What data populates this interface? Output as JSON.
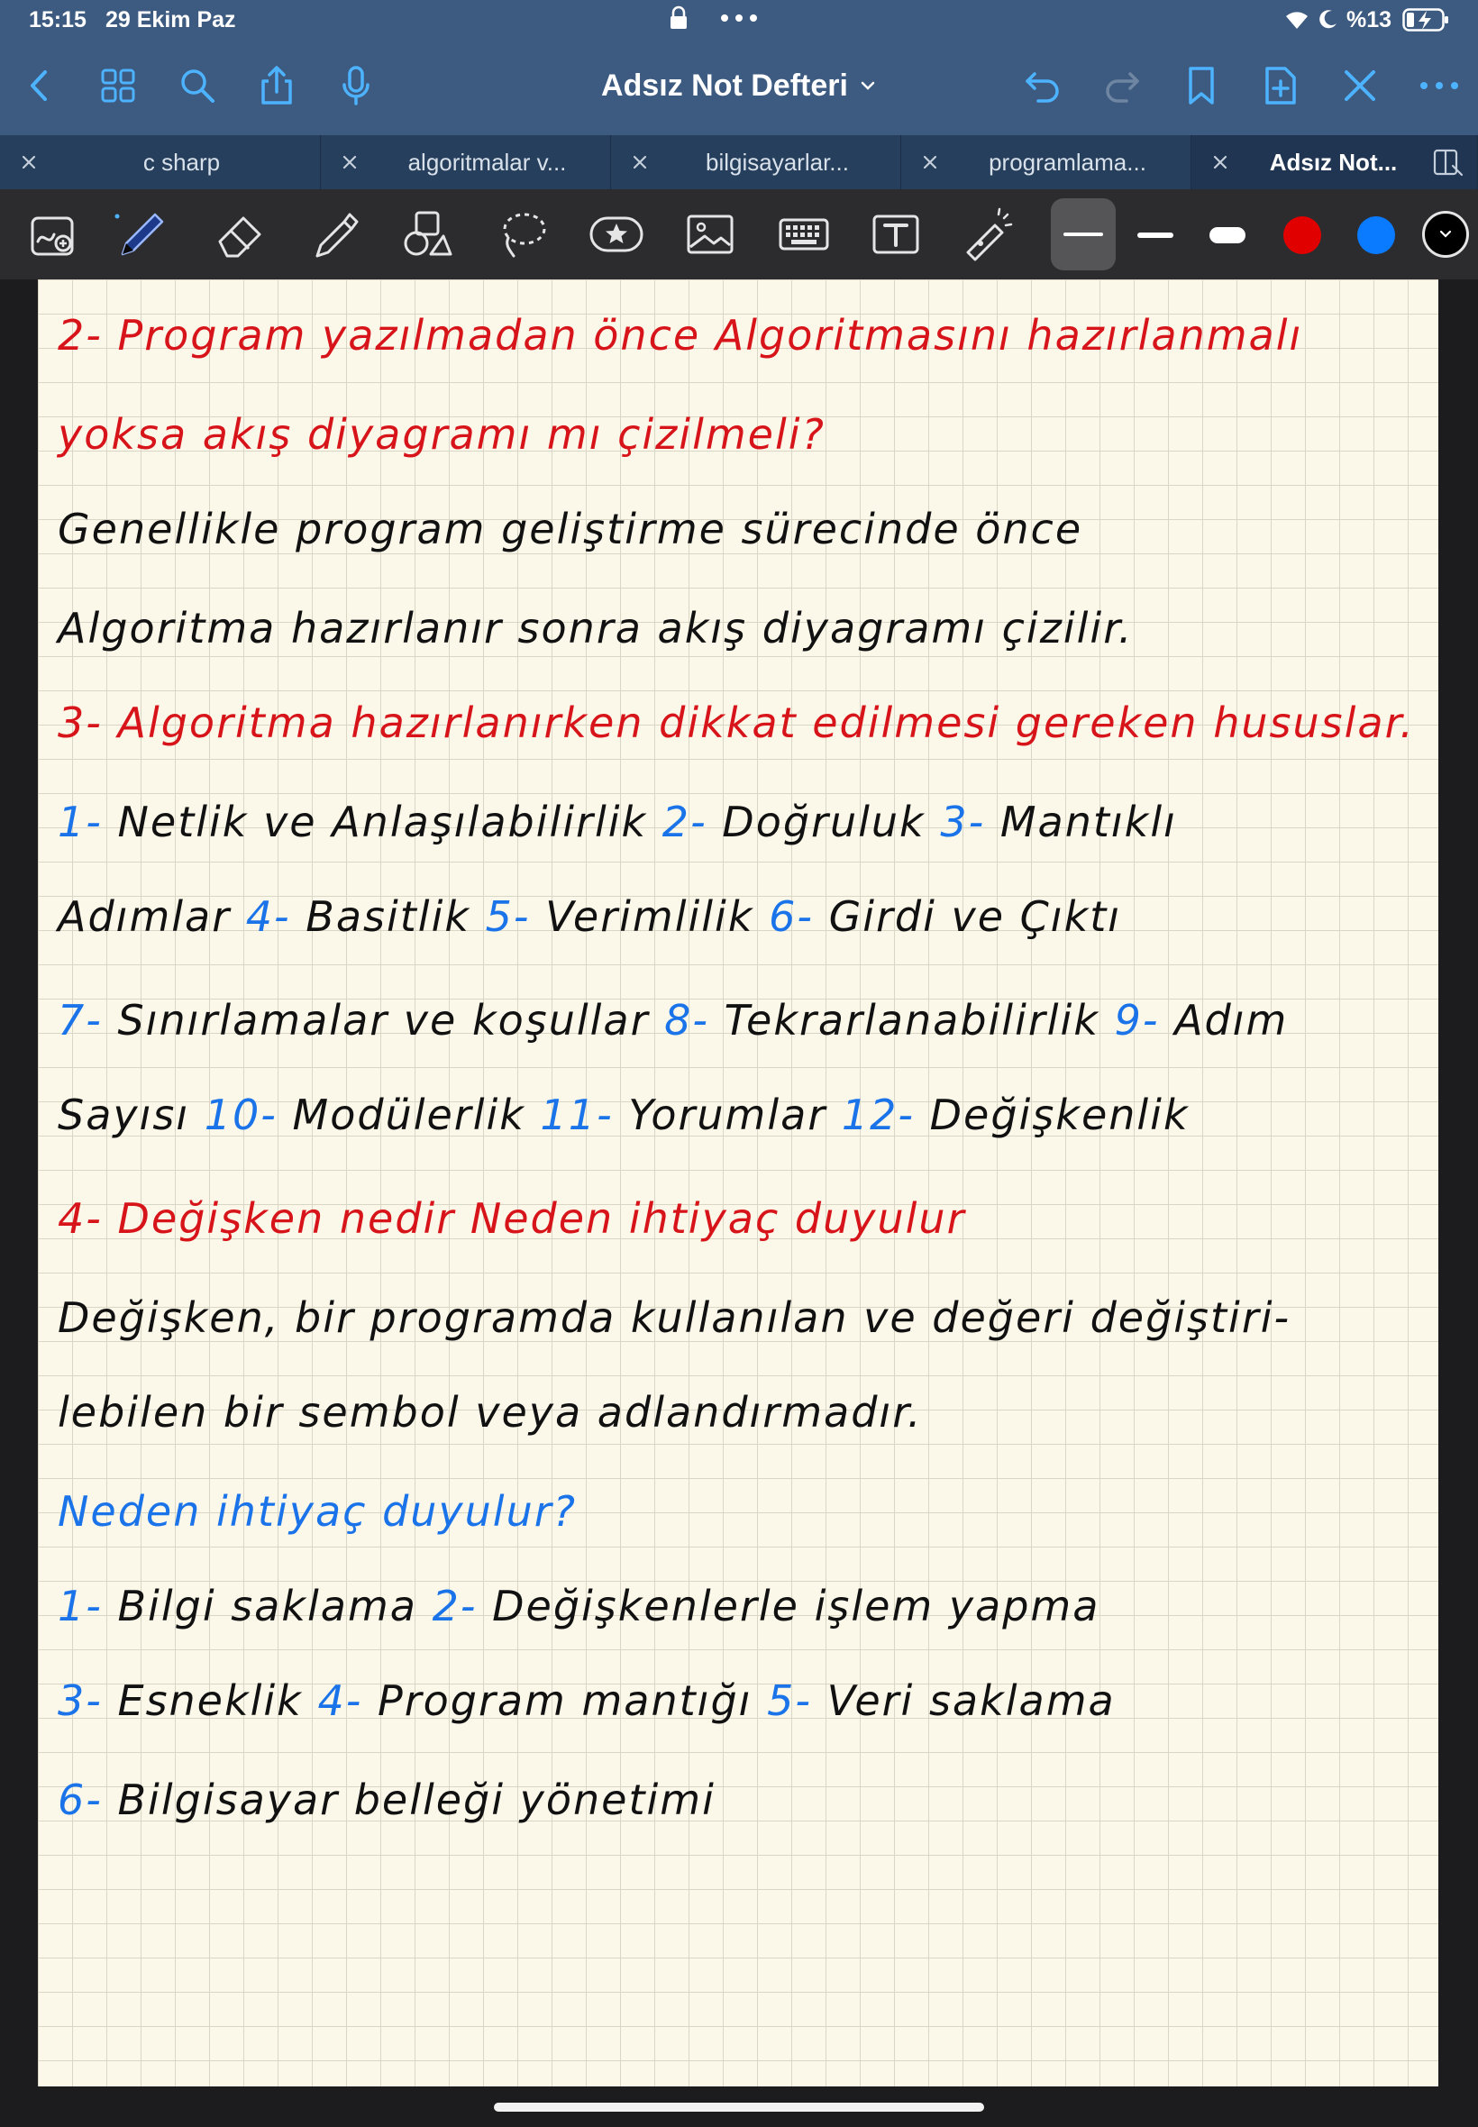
{
  "status_bar": {
    "time": "15:15",
    "date": "29 Ekim Paz",
    "battery_text": "%13"
  },
  "nav": {
    "title": "Adsız Not Defteri",
    "icons": [
      "back-icon",
      "grid-icon",
      "search-icon",
      "share-icon",
      "microphone-icon",
      "undo-icon",
      "redo-icon",
      "bookmark-icon",
      "add-page-icon",
      "close-icon",
      "more-icon"
    ]
  },
  "tabs": [
    {
      "label": "c sharp",
      "active": false
    },
    {
      "label": "algoritmalar v...",
      "active": false
    },
    {
      "label": "bilgisayarlar...",
      "active": false
    },
    {
      "label": "programlama...",
      "active": false
    },
    {
      "label": "Adsız Not...",
      "active": true
    }
  ],
  "tools": [
    "lasso-zoom-icon",
    "pen-icon",
    "eraser-icon",
    "highlighter-icon",
    "shapes-icon",
    "lasso-icon",
    "sticker-icon",
    "image-icon",
    "keyboard-icon",
    "text-icon",
    "laser-pointer-icon"
  ],
  "colors": {
    "topbar": "#3d5a80",
    "tabbar": "#263f5c",
    "toolbar": "#2c2c2e",
    "red_ink": "#d7141a",
    "blue_ink": "#1a73e8",
    "black_ink": "#111111",
    "swatch_red": "#e00000",
    "swatch_blue": "#0a7aff",
    "swatch_black": "#000000"
  },
  "note": {
    "lines": [
      {
        "segments": [
          {
            "text": "2- Program yazılmadan önce Algoritmasını hazırlanmalı",
            "color": "red"
          }
        ]
      },
      {
        "segments": [
          {
            "text": "yoksa akış diyagramı mı çizilmeli?",
            "color": "red"
          }
        ]
      },
      {
        "segments": [
          {
            "text": "Genellikle program geliştirme sürecinde önce",
            "color": "black"
          }
        ]
      },
      {
        "segments": [
          {
            "text": "Algoritma hazırlanır sonra akış diyagramı çizilir.",
            "color": "black"
          }
        ]
      },
      {
        "segments": [
          {
            "text": "3- Algoritma hazırlanırken dikkat edilmesi gereken hususlar.",
            "color": "red"
          }
        ]
      },
      {
        "segments": [
          {
            "text": "1- ",
            "color": "blue"
          },
          {
            "text": "Netlik ve Anlaşılabilirlik ",
            "color": "black"
          },
          {
            "text": "2- ",
            "color": "blue"
          },
          {
            "text": "Doğruluk ",
            "color": "black"
          },
          {
            "text": "3- ",
            "color": "blue"
          },
          {
            "text": "Mantıklı",
            "color": "black"
          }
        ]
      },
      {
        "segments": [
          {
            "text": "Adımlar ",
            "color": "black"
          },
          {
            "text": "4- ",
            "color": "blue"
          },
          {
            "text": "Basitlik ",
            "color": "black"
          },
          {
            "text": "5- ",
            "color": "blue"
          },
          {
            "text": "Verimlilik ",
            "color": "black"
          },
          {
            "text": "6- ",
            "color": "blue"
          },
          {
            "text": "Girdi ve Çıktı",
            "color": "black"
          }
        ]
      },
      {
        "segments": [
          {
            "text": "7- ",
            "color": "blue"
          },
          {
            "text": "Sınırlamalar ve koşullar ",
            "color": "black"
          },
          {
            "text": "8- ",
            "color": "blue"
          },
          {
            "text": "Tekrarlanabilirlik ",
            "color": "black"
          },
          {
            "text": "9- ",
            "color": "blue"
          },
          {
            "text": "Adım",
            "color": "black"
          }
        ]
      },
      {
        "segments": [
          {
            "text": "Sayısı ",
            "color": "black"
          },
          {
            "text": "10- ",
            "color": "blue"
          },
          {
            "text": "Modülerlik ",
            "color": "black"
          },
          {
            "text": "11- ",
            "color": "blue"
          },
          {
            "text": "Yorumlar ",
            "color": "black"
          },
          {
            "text": "12- ",
            "color": "blue"
          },
          {
            "text": "Değişkenlik",
            "color": "black"
          }
        ]
      },
      {
        "segments": [
          {
            "text": "4- Değişken nedir Neden ihtiyaç duyulur",
            "color": "red"
          }
        ]
      },
      {
        "segments": [
          {
            "text": "Değişken, bir programda kullanılan ve değeri değiştiri-",
            "color": "black"
          }
        ]
      },
      {
        "segments": [
          {
            "text": "lebilen bir sembol veya adlandırmadır.",
            "color": "black"
          }
        ]
      },
      {
        "segments": [
          {
            "text": "Neden ihtiyaç duyulur?",
            "color": "blue"
          }
        ]
      },
      {
        "segments": [
          {
            "text": "1- ",
            "color": "blue"
          },
          {
            "text": "Bilgi saklama ",
            "color": "black"
          },
          {
            "text": "2- ",
            "color": "blue"
          },
          {
            "text": "Değişkenlerle işlem yapma",
            "color": "black"
          }
        ]
      },
      {
        "segments": [
          {
            "text": "3- ",
            "color": "blue"
          },
          {
            "text": "Esneklik ",
            "color": "black"
          },
          {
            "text": "4- ",
            "color": "blue"
          },
          {
            "text": "Program mantığı ",
            "color": "black"
          },
          {
            "text": "5- ",
            "color": "blue"
          },
          {
            "text": "Veri saklama",
            "color": "black"
          }
        ]
      },
      {
        "segments": [
          {
            "text": "6- ",
            "color": "blue"
          },
          {
            "text": "Bilgisayar belleği yönetimi",
            "color": "black"
          }
        ]
      }
    ]
  }
}
